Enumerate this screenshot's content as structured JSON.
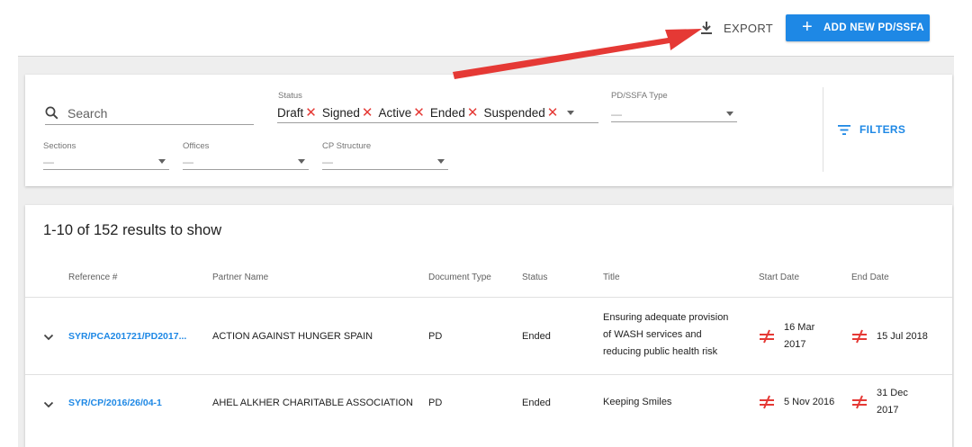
{
  "header": {
    "export_label": "EXPORT",
    "add_label": "ADD NEW PD/SSFA"
  },
  "filters": {
    "search_placeholder": "Search",
    "status_label": "Status",
    "status_chips": [
      "Draft",
      "Signed",
      "Active",
      "Ended",
      "Suspended"
    ],
    "type_label": "PD/SSFA Type",
    "type_value": "—",
    "sections_label": "Sections",
    "sections_value": "—",
    "offices_label": "Offices",
    "offices_value": "—",
    "cp_label": "CP Structure",
    "cp_value": "—",
    "filters_button": "FILTERS"
  },
  "results": {
    "count_text": "1-10 of 152 results to show",
    "columns": [
      "Reference #",
      "Partner Name",
      "Document Type",
      "Status",
      "Title",
      "Start Date",
      "End Date"
    ],
    "rows": [
      {
        "reference": "SYR/PCA201721/PD2017...",
        "partner": "ACTION AGAINST HUNGER SPAIN",
        "doc_type": "PD",
        "status": "Ended",
        "title_lines": [
          "Ensuring adequate provision",
          "of WASH services and",
          "reducing public health risk"
        ],
        "start_lines": [
          "16 Mar",
          "2017"
        ],
        "end_lines": [
          "15 Jul 2018"
        ]
      },
      {
        "reference": "SYR/CP/2016/26/04-1",
        "partner": "AHEL ALKHER CHARITABLE ASSOCIATION",
        "doc_type": "PD",
        "status": "Ended",
        "title_lines": [
          "Keeping Smiles"
        ],
        "start_lines": [
          "5 Nov 2016"
        ],
        "end_lines": [
          "31 Dec",
          "2017"
        ]
      }
    ]
  },
  "colors": {
    "accent": "#1e88e5",
    "chip_remove": "#e53935",
    "annotation_arrow": "#e53935",
    "background": "#eeeeee"
  },
  "icons": {
    "export": "download-icon",
    "add": "plus-icon",
    "search": "search-icon",
    "filters": "filter-lines-icon",
    "row_expand": "chevron-down-icon",
    "date_mismatch": "not-equal-icon",
    "annotation": "red-arrow-icon"
  }
}
